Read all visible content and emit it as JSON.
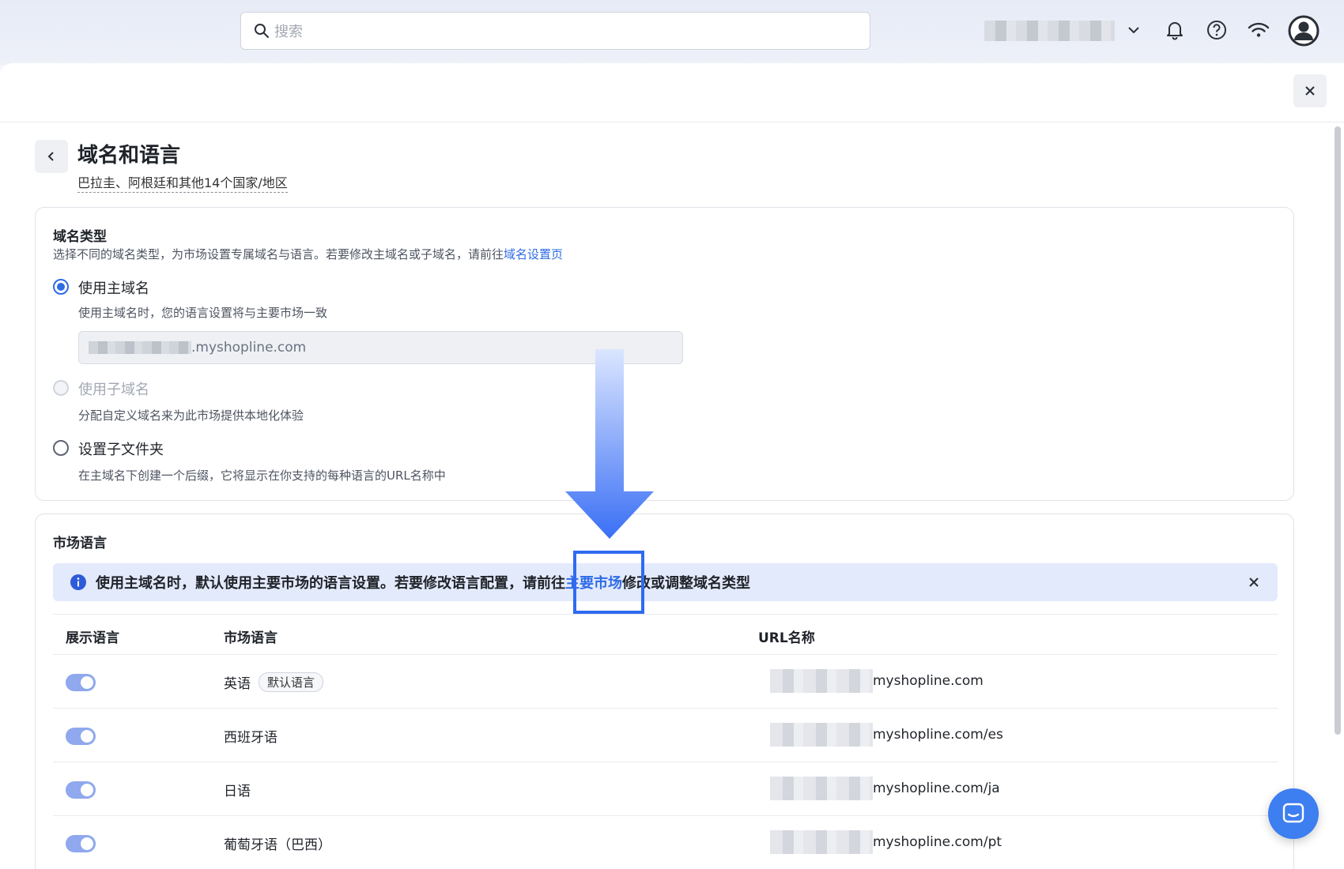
{
  "search": {
    "placeholder": "搜索"
  },
  "modal": {
    "title": "域名和语言",
    "subtitle": "巴拉圭、阿根廷和其他14个国家/地区"
  },
  "domain_type": {
    "title": "域名类型",
    "description_prefix": "选择不同的域名类型，为市场设置专属域名与语言。若要修改主域名或子域名，请前往",
    "description_link": "域名设置页",
    "options": [
      {
        "label": "使用主域名",
        "hint": "使用主域名时，您的语言设置将与主要市场一致",
        "state": "checked"
      },
      {
        "label": "使用子域名",
        "hint": "分配自定义域名来为此市场提供本地化体验",
        "state": "disabled"
      },
      {
        "label": "设置子文件夹",
        "hint": "在主域名下创建一个后缀，它将显示在你支持的每种语言的URL名称中",
        "state": "unchecked"
      }
    ],
    "domain_suffix": ".myshopline.com"
  },
  "market_language": {
    "title": "市场语言",
    "notice_prefix": "使用主域名时，默认使用主要市场的语言设置。若要修改语言配置，请前往",
    "notice_link": "主要市场",
    "notice_suffix": "修改或调整域名类型",
    "columns": [
      "展示语言",
      "市场语言",
      "URL名称"
    ],
    "rows": [
      {
        "enabled": true,
        "language": "英语",
        "badge": "默认语言",
        "url": "myshopline.com"
      },
      {
        "enabled": true,
        "language": "西班牙语",
        "badge": "",
        "url": "myshopline.com/es"
      },
      {
        "enabled": true,
        "language": "日语",
        "badge": "",
        "url": "myshopline.com/ja"
      },
      {
        "enabled": true,
        "language": "葡萄牙语（巴西）",
        "badge": "",
        "url": "myshopline.com/pt"
      }
    ]
  },
  "colors": {
    "accent": "#2e6be6",
    "annotation": "#2f6bf0",
    "notice_bg": "#e3eafc"
  },
  "icons": [
    "search-icon",
    "chevron-down-icon",
    "bell-icon",
    "help-icon",
    "wifi-icon",
    "user-avatar-icon",
    "close-icon",
    "chevron-left-icon",
    "info-icon",
    "chat-icon"
  ]
}
